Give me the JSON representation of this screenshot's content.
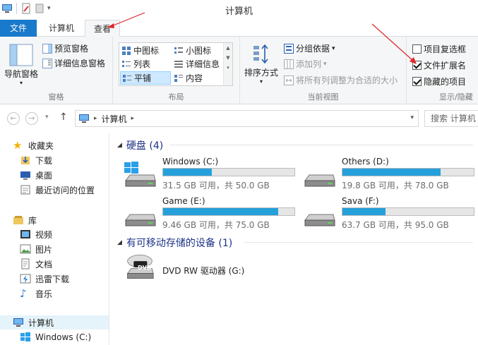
{
  "window": {
    "title": "计算机"
  },
  "tabs": {
    "file": "文件",
    "computer": "计算机",
    "view": "查看"
  },
  "ribbon": {
    "panes": {
      "label": "窗格",
      "nav_pane": "导航窗格",
      "preview_pane": "预览窗格",
      "details_pane": "详细信息窗格"
    },
    "layout": {
      "label": "布局",
      "items": [
        "中图标",
        "小图标",
        "列表",
        "详细信息",
        "平铺",
        "内容"
      ],
      "selected": "平铺"
    },
    "current_view": {
      "label": "当前视图",
      "sort_by": "排序方式",
      "group_by": "分组依据",
      "add_columns": "添加列",
      "size_all_columns": "将所有列调整为合适的大小"
    },
    "show_hide": {
      "label": "显示/隐藏",
      "item_checkboxes": {
        "label": "项目复选框",
        "checked": false
      },
      "file_extensions": {
        "label": "文件扩展名",
        "checked": true
      },
      "hidden_items": {
        "label": "隐藏的项目",
        "checked": true
      }
    }
  },
  "address": {
    "path": "计算机",
    "search_placeholder": "搜索 计算机"
  },
  "nav": {
    "favorites": "收藏夹",
    "downloads": "下载",
    "desktop": "桌面",
    "recent": "最近访问的位置",
    "libraries": "库",
    "videos": "视频",
    "pictures": "图片",
    "documents": "文档",
    "thunder": "迅雷下载",
    "music": "音乐",
    "computer": "计算机",
    "windows_c": "Windows (C:)"
  },
  "content": {
    "hard_disks_header": "硬盘 (4)",
    "removable_header": "有可移动存储的设备 (1)",
    "drives": [
      {
        "name": "Windows (C:)",
        "size_text": "31.5 GB 可用，共 50.0 GB",
        "used_fraction": 0.37
      },
      {
        "name": "Others (D:)",
        "size_text": "19.8 GB 可用，共 78.0 GB",
        "used_fraction": 0.746
      },
      {
        "name": "Game (E:)",
        "size_text": "9.46 GB 可用，共 75.0 GB",
        "used_fraction": 0.874
      },
      {
        "name": "Sava (F:)",
        "size_text": "63.7 GB 可用，共 95.0 GB",
        "used_fraction": 0.329
      }
    ],
    "dvd": {
      "name": "DVD RW 驱动器 (G:)",
      "badge": "DVD"
    }
  },
  "colors": {
    "accent": "#1979ca",
    "bar_fill": "#26a0da",
    "header_text": "#1e3287",
    "arrow": "#e0262a"
  }
}
